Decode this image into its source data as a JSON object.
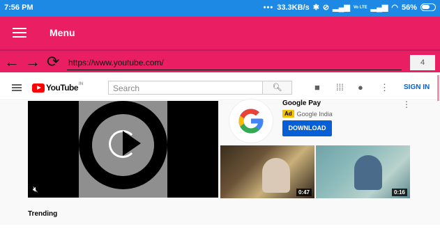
{
  "status_bar": {
    "time": "7:56 PM",
    "network_speed": "33.3KB/s",
    "volte": "Vo LTE",
    "battery": "56%"
  },
  "app_bar": {
    "title": "Menu"
  },
  "nav_bar": {
    "url": "https://www.youtube.com/",
    "tab_count": "4"
  },
  "youtube": {
    "logo_text": "YouTube",
    "country_code": "IN",
    "search_placeholder": "Search",
    "sign_in": "SIGN IN"
  },
  "ad": {
    "title": "Google Pay",
    "badge": "Ad",
    "advertiser": "Google India",
    "cta": "DOWNLOAD"
  },
  "thumbnails": [
    {
      "duration": "0:47"
    },
    {
      "duration": "0:16"
    }
  ],
  "section": {
    "heading": "Trending"
  },
  "colors": {
    "status_bar": "#1e88e5",
    "app_bar": "#e91e63",
    "youtube_red": "#ff0000",
    "link_blue": "#065fd4",
    "ad_badge": "#f2c200"
  }
}
